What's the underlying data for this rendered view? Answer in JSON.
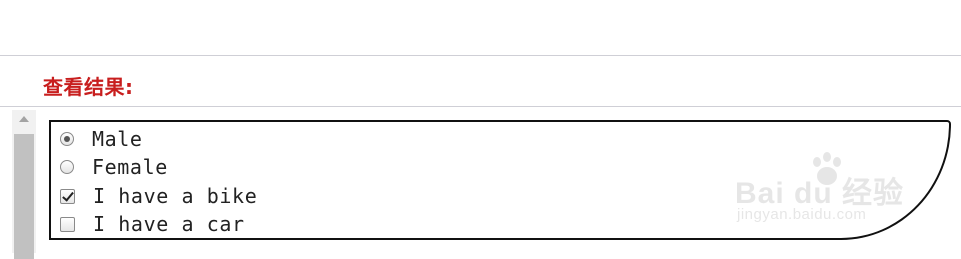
{
  "section": {
    "title": "查看结果:"
  },
  "form": {
    "radios": [
      {
        "label": "Male",
        "checked": true
      },
      {
        "label": "Female",
        "checked": false
      }
    ],
    "checkboxes": [
      {
        "label": "I have a bike",
        "checked": true
      },
      {
        "label": "I have a car",
        "checked": false
      }
    ]
  },
  "watermark": {
    "logo": "Bai du 经验",
    "domain": "jingyan.baidu.com"
  },
  "colors": {
    "title": "#c81e1e",
    "divider": "#cfcfd6",
    "box_border": "#111111"
  }
}
